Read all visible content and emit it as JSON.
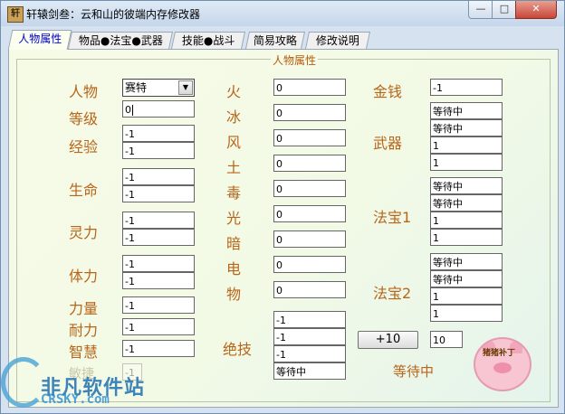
{
  "window": {
    "title": "轩辕剑叁：云和山的彼端内存修改器",
    "app_icon_text": "轩",
    "min_glyph": "—",
    "max_glyph": "□",
    "close_glyph": "✕"
  },
  "tabs": [
    {
      "label": "人物属性",
      "active": true
    },
    {
      "label": "物品●法宝●武器",
      "active": false
    },
    {
      "label": "技能●战斗",
      "active": false
    },
    {
      "label": "简易攻略",
      "active": false
    },
    {
      "label": "修改说明",
      "active": false
    }
  ],
  "group_title": "人物属性",
  "character": {
    "name_label": "人物",
    "name_value": "赛特",
    "level_label": "等级",
    "level_value": "0",
    "exp_label": "经验",
    "exp_values": [
      "-1",
      "-1"
    ],
    "life_label": "生命",
    "life_values": [
      "-1",
      "-1"
    ],
    "spirit_label": "灵力",
    "spirit_values": [
      "-1",
      "-1"
    ],
    "stamina_label": "体力",
    "stamina_values": [
      "-1",
      "-1"
    ],
    "strength_label": "力量",
    "strength_value": "-1",
    "endurance_label": "耐力",
    "endurance_value": "-1",
    "wisdom_label": "智慧",
    "wisdom_value": "-1",
    "agility_label": "敏捷",
    "agility_value": "-1"
  },
  "elements": [
    {
      "label": "火",
      "value": "0"
    },
    {
      "label": "冰",
      "value": "0"
    },
    {
      "label": "风",
      "value": "0"
    },
    {
      "label": "土",
      "value": "0"
    },
    {
      "label": "毒",
      "value": "0"
    },
    {
      "label": "光",
      "value": "0"
    },
    {
      "label": "暗",
      "value": "0"
    },
    {
      "label": "电",
      "value": "0"
    },
    {
      "label": "物",
      "value": "0"
    }
  ],
  "skill": {
    "label": "绝技",
    "values": [
      "-1",
      "-1",
      "-1",
      "等待中"
    ]
  },
  "money": {
    "label": "金钱",
    "value": "-1"
  },
  "weapon": {
    "label": "武器",
    "values": [
      "等待中",
      "等待中",
      "1",
      "1"
    ]
  },
  "treasure1": {
    "label": "法宝1",
    "values": [
      "等待中",
      "等待中",
      "1",
      "1"
    ]
  },
  "treasure2": {
    "label": "法宝2",
    "values": [
      "等待中",
      "等待中",
      "1",
      "1"
    ]
  },
  "plus_button": "+10",
  "plus_value": "10",
  "status_text": "等待中",
  "watermark": {
    "text": "非凡软件站",
    "url": "CRSKY.com"
  },
  "mascot_text": "猪猪补丁"
}
